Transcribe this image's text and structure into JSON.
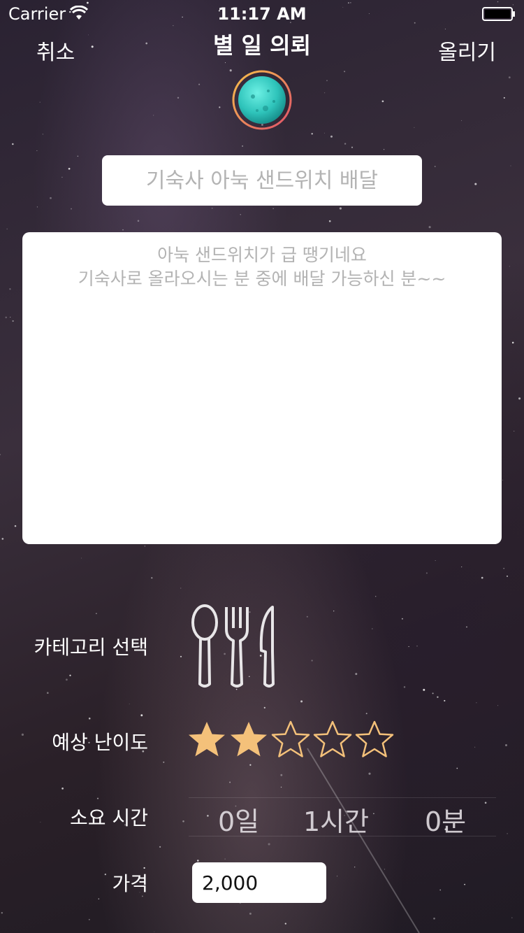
{
  "status_bar": {
    "carrier": "Carrier",
    "time": "11:17 AM"
  },
  "nav": {
    "cancel_label": "취소",
    "title": "별 일 의뢰",
    "submit_label": "올리기"
  },
  "form": {
    "title_placeholder": "기숙사 아눅 샌드위치 배달",
    "content_placeholder": "아눅 샌드위치가 급 땡기네요\n기숙사로 올라오시는 분 중에 배달 가능하신 분~~",
    "category_label": "카테고리 선택",
    "category_icon": "fork-spoon-knife-icon",
    "difficulty_label": "예상 난이도",
    "difficulty_rating": 2,
    "difficulty_max": 5,
    "duration_label": "소요 시간",
    "duration_days": "0일",
    "duration_hours": "1시간",
    "duration_minutes": "0분",
    "price_label": "가격",
    "price_value": "2,000"
  },
  "colors": {
    "star_filled": "#f4c17a",
    "star_outline": "#f4c17a",
    "planet": "#3fd6cc",
    "planet_ring": "#f5b04d"
  }
}
